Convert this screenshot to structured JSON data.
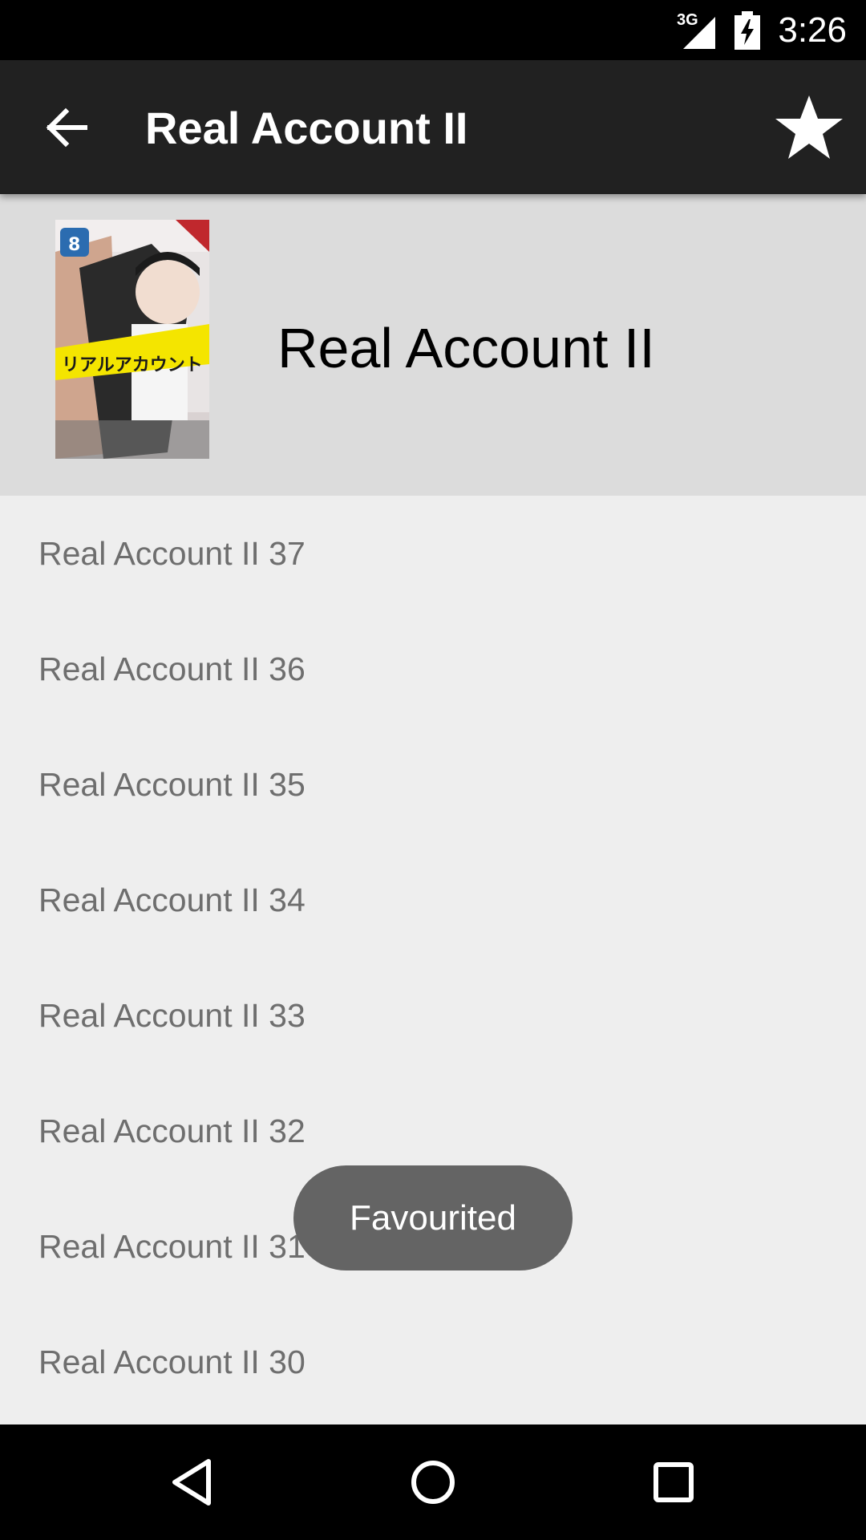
{
  "status_bar": {
    "network": "3G",
    "time": "3:26"
  },
  "app_bar": {
    "title": "Real Account II"
  },
  "header": {
    "series_title": "Real Account II"
  },
  "chapters": [
    "Real Account II 37",
    "Real Account II 36",
    "Real Account II 35",
    "Real Account II 34",
    "Real Account II 33",
    "Real Account II 32",
    "Real Account II 31",
    "Real Account II 30"
  ],
  "toast": {
    "message": "Favourited"
  },
  "icons": {
    "back": "arrow-back-icon",
    "favourite": "star-icon",
    "nav_back": "triangle-back-icon",
    "nav_home": "circle-home-icon",
    "nav_recents": "square-recents-icon"
  }
}
